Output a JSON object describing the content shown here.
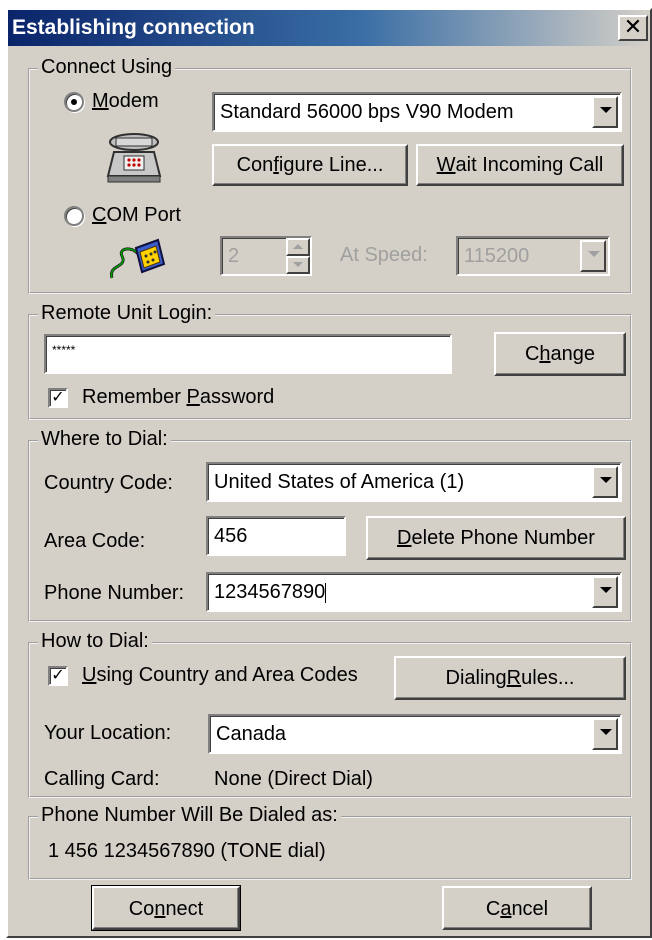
{
  "window": {
    "title": "Establishing connection",
    "close_glyph": "✕"
  },
  "connect_using": {
    "group_title": "Connect Using",
    "modem_radio": {
      "label_pre": "",
      "label_u": "M",
      "label_post": "odem",
      "selected": true
    },
    "modem_select": {
      "value": "Standard 56000 bps V90 Modem"
    },
    "configure_line_button": {
      "pre": "Con",
      "u": "f",
      "post": "igure Line..."
    },
    "wait_incoming_button": {
      "pre": "",
      "u": "W",
      "post": "ait Incoming Call"
    },
    "com_port_radio": {
      "label_pre": "",
      "label_u": "C",
      "label_post": "OM Port",
      "selected": false
    },
    "port_spinner": {
      "value": "2"
    },
    "at_speed_label": "At Speed:",
    "speed_select": {
      "value": "115200"
    },
    "icons": [
      "telephone-modem-icon",
      "serial-cable-icon"
    ]
  },
  "remote_login": {
    "group_title": "Remote Unit Login:",
    "password_field": {
      "value": "*****"
    },
    "change_button": {
      "pre": "C",
      "u": "h",
      "post": "ange"
    },
    "remember_checkbox": {
      "pre": "Remember ",
      "u": "P",
      "post": "assword",
      "checked": true,
      "check_glyph": "✓"
    }
  },
  "where_to_dial": {
    "group_title": "Where to Dial:",
    "country_label": "Country Code:",
    "country_select": {
      "value": "United States of America (1)"
    },
    "area_label": "Area Code:",
    "area_field": {
      "value": "456"
    },
    "delete_phone_button": {
      "pre": "",
      "u": "D",
      "post": "elete Phone Number"
    },
    "phone_label": "Phone Number:",
    "phone_select": {
      "value": "1234567890"
    }
  },
  "how_to_dial": {
    "group_title": "How to Dial:",
    "use_codes_checkbox": {
      "pre": "",
      "u": "U",
      "post": "sing Country and Area Codes",
      "checked": true,
      "check_glyph": "✓"
    },
    "dialing_rules_button": {
      "pre": "Dialing ",
      "u": "R",
      "post": "ules..."
    },
    "location_label": "Your Location:",
    "location_select": {
      "value": "Canada"
    },
    "calling_card_label": "Calling Card:",
    "calling_card_value": "None (Direct Dial)"
  },
  "dialed_as": {
    "group_title": "Phone Number Will Be Dialed as:",
    "value": "1 456 1234567890 (TONE dial)"
  },
  "footer": {
    "connect_button": {
      "pre": "Co",
      "u": "n",
      "post": "nect"
    },
    "cancel_button": {
      "pre": "C",
      "u": "a",
      "post": "ncel"
    }
  },
  "colors": {
    "title_gradient_start": "#0a246a",
    "title_gradient_end": "#d4d0c8",
    "face": "#d4d0c8"
  }
}
